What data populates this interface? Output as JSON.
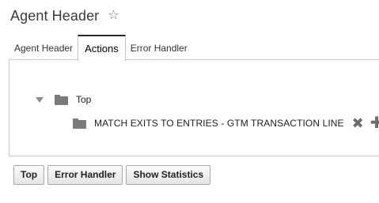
{
  "header": {
    "title": "Agent Header",
    "favorite_icon": "☆"
  },
  "tabs": [
    {
      "label": "Agent Header",
      "active": false
    },
    {
      "label": "Actions",
      "active": true
    },
    {
      "label": "Error Handler",
      "active": false
    }
  ],
  "tree": {
    "root": {
      "label": "Top",
      "expanded": true,
      "icon": "folder-icon"
    },
    "child": {
      "label": "MATCH EXITS TO ENTRIES - GTM TRANSACTION LINE",
      "icon": "folder-icon",
      "remove_icon": "✖",
      "add_icon": "✚"
    }
  },
  "buttons": {
    "top": "Top",
    "error_handler": "Error Handler",
    "show_statistics": "Show Statistics"
  }
}
